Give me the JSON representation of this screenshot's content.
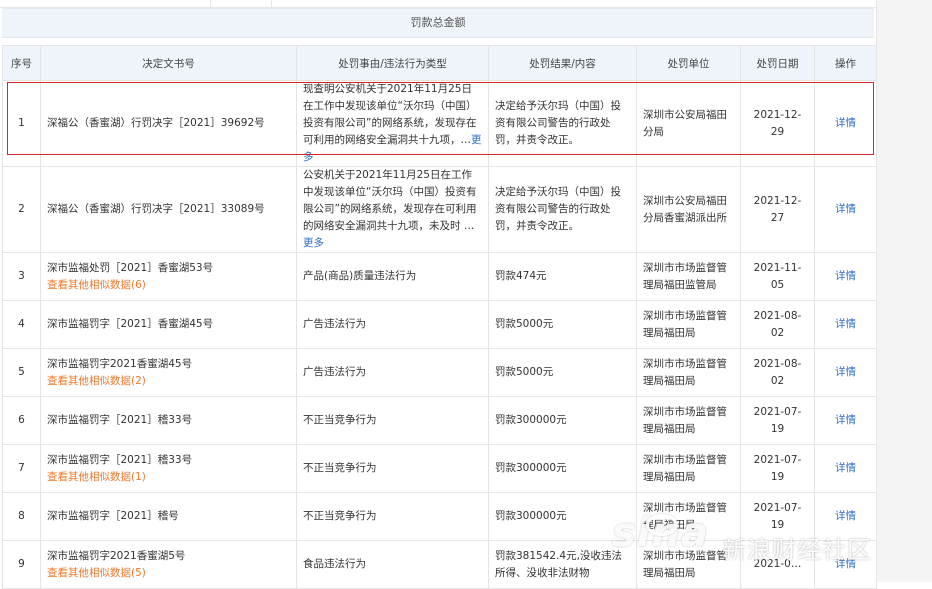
{
  "summary": {
    "label": "罚款总金额"
  },
  "columns": [
    "序号",
    "决定文书号",
    "处罚事由/违法行为类型",
    "处罚结果/内容",
    "处罚单位",
    "处罚日期",
    "操作"
  ],
  "rows": [
    {
      "idx": "1",
      "doc": "深福公（香蜜湖）行罚决字［2021］39692号",
      "similar": "",
      "reason": "现查明公安机关于2021年11月25日在工作中发现该单位“沃尔玛（中国）投资有限公司”的网络系统，发现存在可利用的网络安全漏洞共十九项，…",
      "more": "更多",
      "result": "决定给予沃尔玛（中国）投资有限公司警告的行政处罚，并责令改正。",
      "unit": "深圳市公安局福田分局",
      "date": "2021-12-29",
      "op": "详情"
    },
    {
      "idx": "2",
      "doc": "深福公（香蜜湖）行罚决字［2021］33089号",
      "similar": "",
      "reason": "公安机关于2021年11月25日在工作中发现该单位“沃尔玛（中国）投资有限公司”的网络系统，发现存在可利用的网络安全漏洞共十九项，未及时 …",
      "more": "更多",
      "result": "决定给予沃尔玛（中国）投资有限公司警告的行政处罚，并责令改正。",
      "unit": "深圳市公安局福田分局香蜜湖派出所",
      "date": "2021-12-27",
      "op": "详情"
    },
    {
      "idx": "3",
      "doc": "深市监福处罚［2021］香蜜湖53号",
      "similar": "查看其他相似数据(6)",
      "reason": "产品(商品)质量违法行为",
      "more": "",
      "result": "罚款474元",
      "unit": "深圳市市场监督管理局福田监管局",
      "date": "2021-11-05",
      "op": "详情"
    },
    {
      "idx": "4",
      "doc": "深市监福罚字［2021］香蜜湖45号",
      "similar": "",
      "reason": "广告违法行为",
      "more": "",
      "result": "罚款5000元",
      "unit": "深圳市市场监督管理局福田局",
      "date": "2021-08-02",
      "op": "详情"
    },
    {
      "idx": "5",
      "doc": "深市监福罚字2021香蜜湖45号",
      "similar": "查看其他相似数据(2)",
      "reason": "广告违法行为",
      "more": "",
      "result": "罚款5000元",
      "unit": "深圳市市场监督管理局福田局",
      "date": "2021-08-02",
      "op": "详情"
    },
    {
      "idx": "6",
      "doc": "深市监福罚字［2021］稽33号",
      "similar": "",
      "reason": "不正当竞争行为",
      "more": "",
      "result": "罚款300000元",
      "unit": "深圳市市场监督管理局福田局",
      "date": "2021-07-19",
      "op": "详情"
    },
    {
      "idx": "7",
      "doc": "深市监福罚字［2021］稽33号",
      "similar": "查看其他相似数据(1)",
      "reason": "不正当竞争行为",
      "more": "",
      "result": "罚款300000元",
      "unit": "深圳市市场监督管理局福田局",
      "date": "2021-07-19",
      "op": "详情"
    },
    {
      "idx": "8",
      "doc": "深市监福罚字［2021］稽号",
      "similar": "",
      "reason": "不正当竞争行为",
      "more": "",
      "result": "罚款300000元",
      "unit": "深圳市市场监督管理局福田局",
      "date": "2021-07-19",
      "op": "详情"
    },
    {
      "idx": "9",
      "doc": "深市监福罚字2021香蜜湖5号",
      "similar": "查看其他相似数据(5)",
      "reason": "食品违法行为",
      "more": "",
      "result": "罚款381542.4元,没收违法所得、没收非法财物",
      "unit": "深圳市市场监督管理局福田局",
      "date": "2021-0…",
      "op": "详情"
    }
  ],
  "watermark": {
    "logo": "sina",
    "text": "新浪财经社区"
  },
  "colors": {
    "highlight": "#d9232d",
    "link": "#2e6fc7",
    "similar": "#f2782a",
    "header_bg": "#eef4fa"
  }
}
